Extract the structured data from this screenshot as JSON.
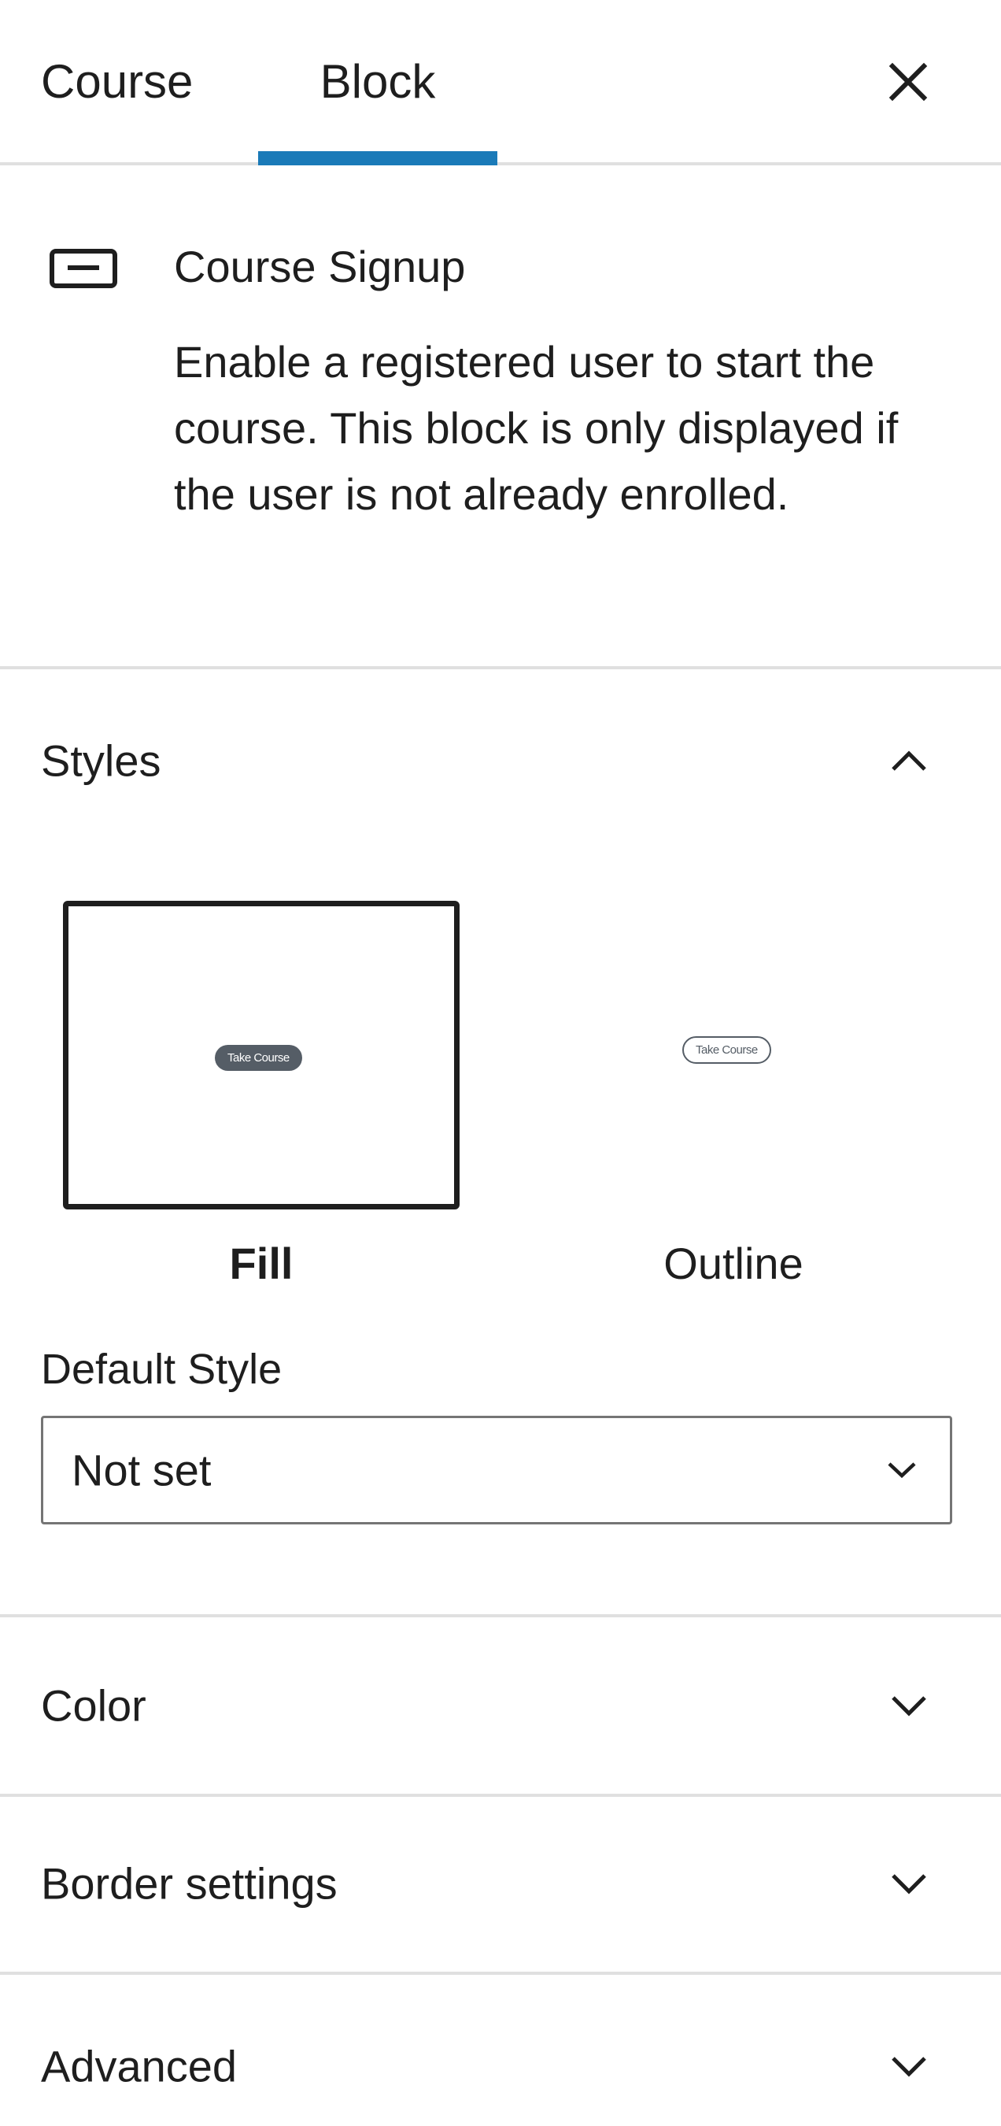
{
  "tabs": [
    {
      "label": "Course",
      "active": false
    },
    {
      "label": "Block",
      "active": true
    }
  ],
  "accent_color": "#1a7ab8",
  "close_icon": "close-icon",
  "block": {
    "icon": "button-block-icon",
    "title": "Course Signup",
    "description": "Enable a registered user to start the course. This block is only displayed if the user is not already enrolled."
  },
  "styles": {
    "title": "Styles",
    "expanded": true,
    "options": [
      {
        "label": "Fill",
        "preview_text": "Take Course",
        "selected": true
      },
      {
        "label": "Outline",
        "preview_text": "Take Course",
        "selected": false
      }
    ],
    "default_style_label": "Default Style",
    "default_style_value": "Not set"
  },
  "panels": [
    {
      "title": "Color",
      "expanded": false
    },
    {
      "title": "Border settings",
      "expanded": false
    },
    {
      "title": "Advanced",
      "expanded": false
    }
  ]
}
